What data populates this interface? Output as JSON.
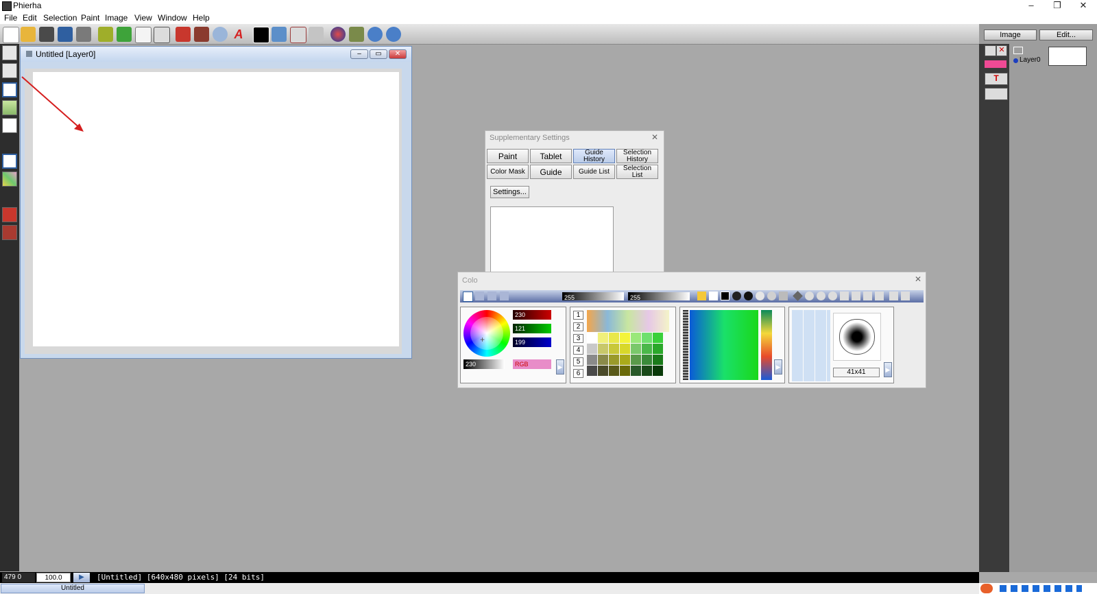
{
  "window": {
    "title": "Phierha",
    "minimize": "–",
    "restore": "❐",
    "close": "✕"
  },
  "menu": [
    "File",
    "Edit",
    "Selection",
    "Paint",
    "Image",
    "View",
    "Window",
    "Help"
  ],
  "toolbar_icons": [
    "new-file-icon",
    "open-folder-icon",
    "camera-icon",
    "save-icon",
    "print-icon",
    "undo-icon",
    "redo-icon",
    "copy-icon",
    "paste-icon",
    "stamp-red-icon",
    "stamp-icon",
    "magnifier-icon",
    "text-a-icon",
    "black-color-icon",
    "image-icon",
    "layer-icon",
    "clipboard-icon",
    "globe-icon",
    "brush-tool-icon",
    "zoom-in-icon",
    "zoom-out-icon"
  ],
  "document": {
    "title": "Untitled [Layer0]"
  },
  "layers": {
    "tab_image": "Image",
    "tab_edit": "Edit...",
    "layer_name": "Layer0",
    "layer_color": "#f04a95"
  },
  "supplementary": {
    "title": "Supplementary Settings",
    "close": "✕",
    "buttons_row1": [
      "Paint",
      "Tablet",
      "Guide History",
      "Selection History"
    ],
    "buttons_row2": [
      "Color Mask",
      "Guide",
      "Guide List",
      "Selection List"
    ],
    "settings_button": "Settings..."
  },
  "color": {
    "title": "Colo",
    "close": "✕",
    "red": "230",
    "green": "121",
    "blue": "199",
    "gray": "230",
    "mode": "RGB",
    "bar_value_1": "255",
    "bar_value_2": "255",
    "palette_numbers": [
      "1",
      "2",
      "3",
      "4",
      "5",
      "6"
    ],
    "brush_size": "41x41"
  },
  "status": {
    "coords": "479 0",
    "zoom": "100.0",
    "info": "[Untitled] [640x480 pixels] [24 bits]",
    "task": "Untitled"
  }
}
